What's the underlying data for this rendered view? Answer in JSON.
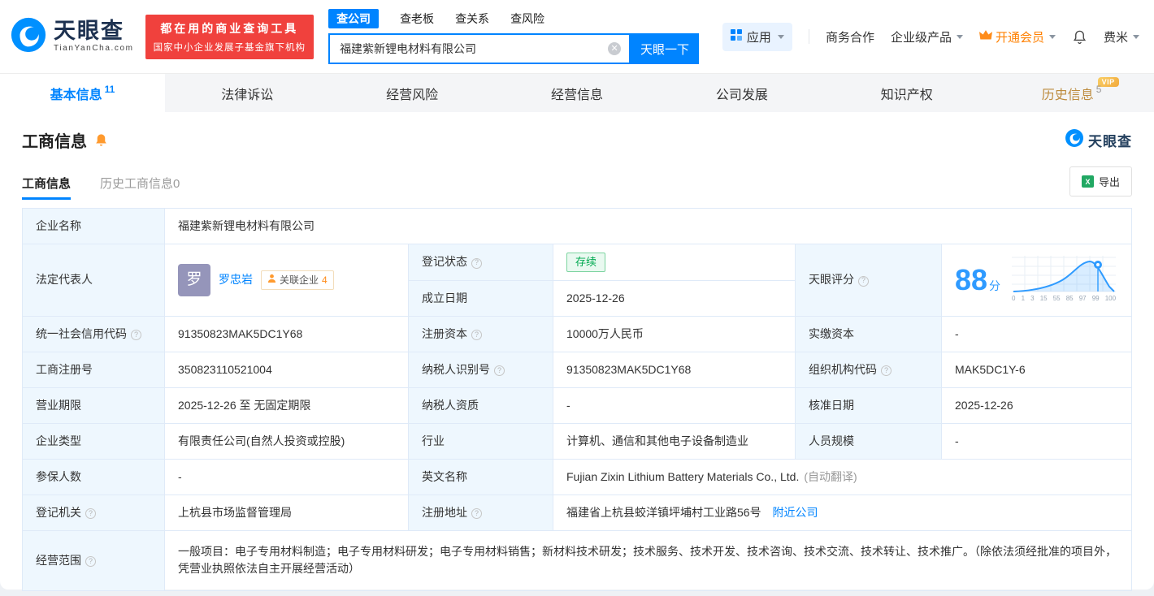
{
  "colors": {
    "brand_blue": "#0084ff",
    "banner_red": "#f0413d",
    "vip_orange": "#ff8000",
    "status_green": "#00a94f",
    "label_cell_bg": "#eef7fe"
  },
  "header": {
    "brand": "天眼查",
    "brand_domain": "TianYanCha.com",
    "promo_line1": "都在用的商业查询工具",
    "promo_line2": "国家中小企业发展子基金旗下机构",
    "search_tabs": [
      "查公司",
      "查老板",
      "查关系",
      "查风险"
    ],
    "search_value": "福建紫新锂电材料有限公司",
    "search_button": "天眼一下",
    "apps": "应用",
    "biz_cooperation": "商务合作",
    "enterprise_products": "企业级产品",
    "vip_upgrade": "开通会员",
    "username": "费米"
  },
  "nav_tabs": [
    {
      "label": "基本信息",
      "count": "11"
    },
    {
      "label": "法律诉讼"
    },
    {
      "label": "经营风险"
    },
    {
      "label": "经营信息"
    },
    {
      "label": "公司发展"
    },
    {
      "label": "知识产权"
    },
    {
      "label": "历史信息",
      "count": "5",
      "badge": "VIP"
    }
  ],
  "section": {
    "title": "工商信息",
    "watermark": "天眼查",
    "subtab_active": "工商信息",
    "subtab_history": "历史工商信息0",
    "export_label": "导出"
  },
  "info": {
    "company_name": {
      "label": "企业名称",
      "value": "福建紫新锂电材料有限公司"
    },
    "legal_rep": {
      "label": "法定代表人",
      "avatar": "罗",
      "name": "罗忠岩",
      "related": "关联企业",
      "related_count": "4"
    },
    "reg_status": {
      "label": "登记状态",
      "value": "存续"
    },
    "est_date": {
      "label": "成立日期",
      "value": "2025-12-26"
    },
    "score": {
      "label": "天眼评分",
      "value": "88",
      "unit": "分",
      "ticks": [
        "0",
        "1",
        "3",
        "15",
        "55",
        "85",
        "97",
        "99",
        "100"
      ]
    },
    "credit_code": {
      "label": "统一社会信用代码",
      "value": "91350823MAK5DC1Y68"
    },
    "reg_capital": {
      "label": "注册资本",
      "value": "10000万人民币"
    },
    "paid_capital": {
      "label": "实缴资本",
      "value": "-"
    },
    "reg_no": {
      "label": "工商注册号",
      "value": "350823110521004"
    },
    "tax_id": {
      "label": "纳税人识别号",
      "value": "91350823MAK5DC1Y68"
    },
    "org_code": {
      "label": "组织机构代码",
      "value": "MAK5DC1Y-6"
    },
    "term": {
      "label": "营业期限",
      "value": "2025-12-26 至 无固定期限"
    },
    "tax_quality": {
      "label": "纳税人资质",
      "value": "-"
    },
    "approval_date": {
      "label": "核准日期",
      "value": "2025-12-26"
    },
    "type": {
      "label": "企业类型",
      "value": "有限责任公司(自然人投资或控股)"
    },
    "industry": {
      "label": "行业",
      "value": "计算机、通信和其他电子设备制造业"
    },
    "staff": {
      "label": "人员规模",
      "value": "-"
    },
    "insured": {
      "label": "参保人数",
      "value": "-"
    },
    "en_name": {
      "label": "英文名称",
      "value": "Fujian Zixin Lithium Battery Materials Co., Ltd.",
      "note": "(自动翻译)"
    },
    "authority": {
      "label": "登记机关",
      "value": "上杭县市场监督管理局"
    },
    "address": {
      "label": "注册地址",
      "value": "福建省上杭县蛟洋镇坪埔村工业路56号",
      "link": "附近公司"
    },
    "scope": {
      "label": "经营范围",
      "value": "一般项目：电子专用材料制造；电子专用材料研发；电子专用材料销售；新材料技术研发；技术服务、技术开发、技术咨询、技术交流、技术转让、技术推广。（除依法须经批准的项目外，凭营业执照依法自主开展经营活动）"
    }
  }
}
